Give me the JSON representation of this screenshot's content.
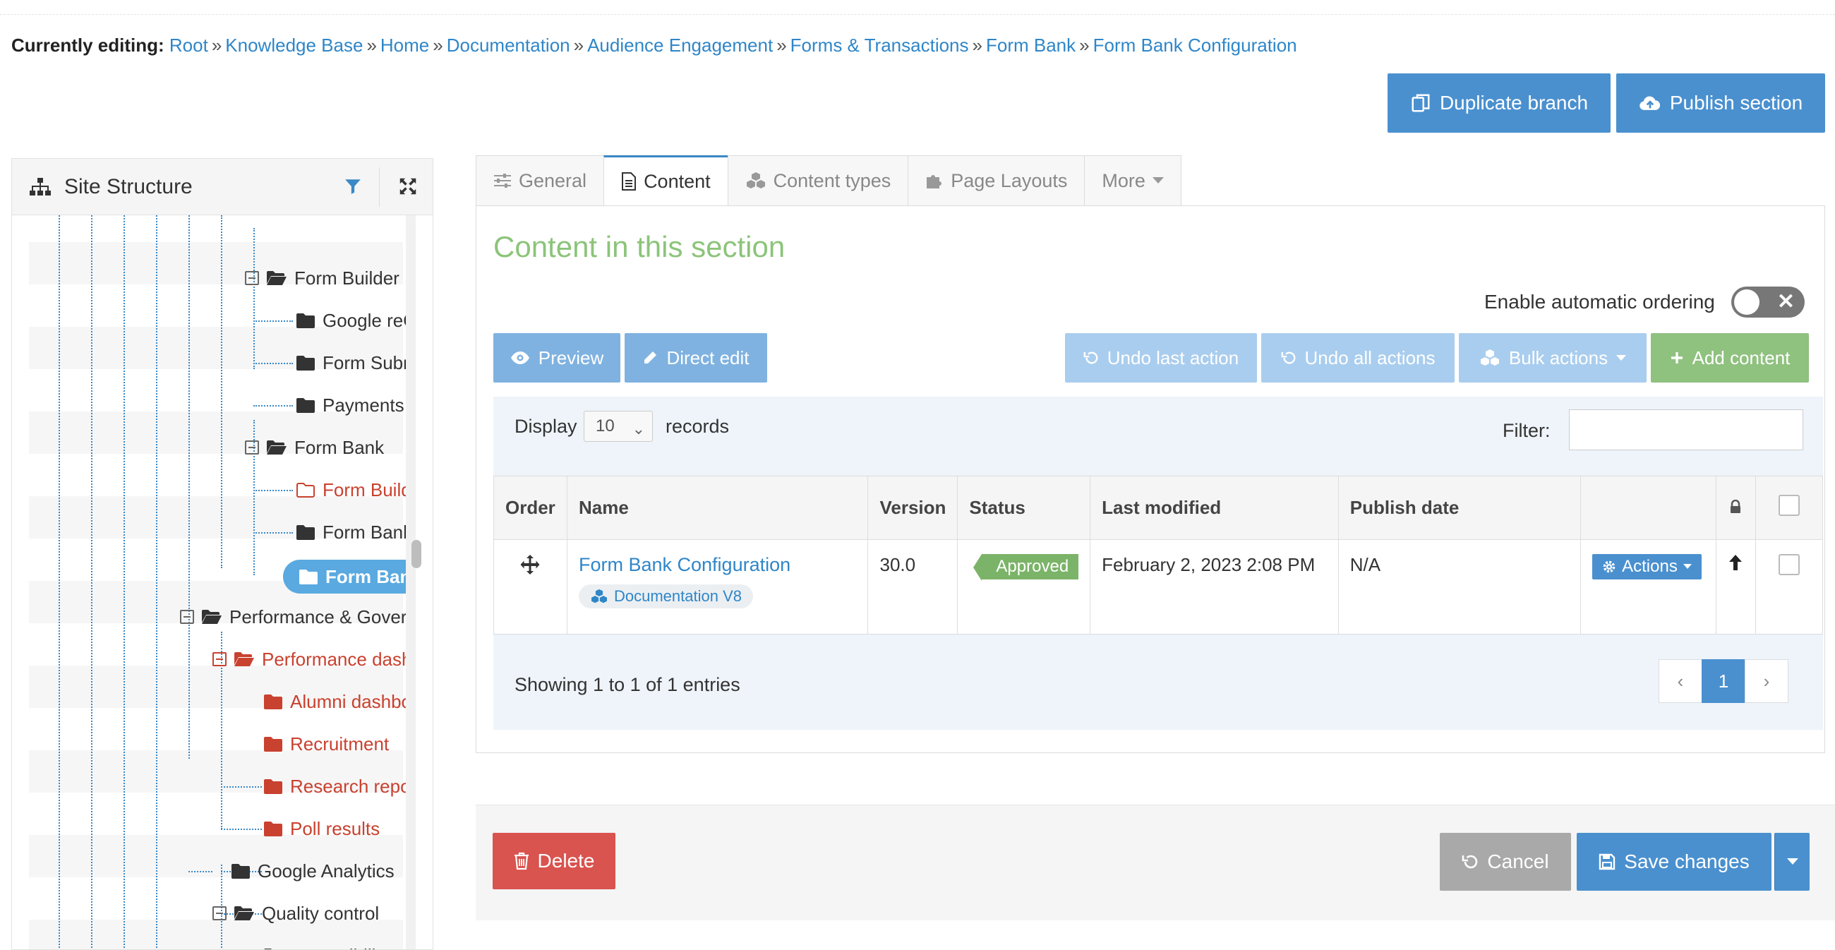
{
  "breadcrumb": {
    "label": "Currently editing:",
    "items": [
      "Root",
      "Knowledge Base",
      "Home",
      "Documentation",
      "Audience Engagement",
      "Forms & Transactions",
      "Form Bank",
      "Form Bank Configuration"
    ],
    "separator": "»"
  },
  "top_actions": {
    "duplicate": "Duplicate branch",
    "publish": "Publish section"
  },
  "sidebar": {
    "title": "Site Structure",
    "icons": [
      "sitemap-icon",
      "filter-icon",
      "expand-icon"
    ],
    "tree": [
      {
        "label": "Form Builder",
        "type": "folder-open",
        "state": "expanded",
        "color": "normal"
      },
      {
        "label": "Google reCAPTCHA",
        "type": "folder",
        "color": "normal"
      },
      {
        "label": "Form Submissions",
        "type": "folder",
        "color": "normal"
      },
      {
        "label": "Payments",
        "type": "folder",
        "color": "normal"
      },
      {
        "label": "Form Bank",
        "type": "folder-open",
        "state": "expanded",
        "color": "normal"
      },
      {
        "label": "Form Builder",
        "type": "folder-outline",
        "color": "red"
      },
      {
        "label": "Form Bank",
        "type": "folder",
        "color": "normal"
      },
      {
        "label": "Form Bank Configuration",
        "type": "folder",
        "color": "active"
      },
      {
        "label": "Performance & Governance",
        "type": "folder-open",
        "state": "expanded",
        "color": "normal"
      },
      {
        "label": "Performance dashboards",
        "type": "folder-open",
        "state": "expanded",
        "color": "red"
      },
      {
        "label": "Alumni dashboard",
        "type": "folder",
        "color": "red"
      },
      {
        "label": "Recruitment",
        "type": "folder",
        "color": "red"
      },
      {
        "label": "Research reports",
        "type": "folder",
        "color": "red"
      },
      {
        "label": "Poll results",
        "type": "folder",
        "color": "red"
      },
      {
        "label": "Google Analytics",
        "type": "folder",
        "color": "normal"
      },
      {
        "label": "Quality control",
        "type": "folder-open",
        "state": "expanded",
        "color": "normal"
      },
      {
        "label": "Accessibility",
        "type": "folder",
        "color": "normal"
      }
    ]
  },
  "tabs": [
    {
      "label": "General",
      "icon": "sliders-icon",
      "active": false
    },
    {
      "label": "Content",
      "icon": "document-icon",
      "active": true
    },
    {
      "label": "Content types",
      "icon": "cubes-icon",
      "active": false
    },
    {
      "label": "Page Layouts",
      "icon": "puzzle-icon",
      "active": false
    },
    {
      "label": "More",
      "icon": "caret-down-icon",
      "active": false
    }
  ],
  "content": {
    "title": "Content in this section",
    "auto_ordering_label": "Enable automatic ordering",
    "auto_ordering_on": false,
    "buttons": {
      "preview": "Preview",
      "direct_edit": "Direct edit",
      "undo_last": "Undo last action",
      "undo_all": "Undo all actions",
      "bulk": "Bulk actions",
      "add": "Add content"
    },
    "display_label": "Display",
    "display_value": "10",
    "records_label": "records",
    "filter_label": "Filter:",
    "filter_value": "",
    "columns": [
      "Order",
      "Name",
      "Version",
      "Status",
      "Last modified",
      "Publish date",
      "",
      "",
      ""
    ],
    "rows": [
      {
        "name": "Form Bank Configuration",
        "tag": "Documentation V8",
        "version": "30.0",
        "status": "Approved",
        "last_modified": "February 2, 2023 2:08 PM",
        "publish_date": "N/A",
        "actions": "Actions"
      }
    ],
    "showing": "Showing 1 to 1 of 1 entries",
    "pager": {
      "prev": "‹",
      "current": "1",
      "next": "›"
    }
  },
  "footer": {
    "delete": "Delete",
    "cancel": "Cancel",
    "save": "Save changes"
  },
  "colors": {
    "primary": "#4a90cf",
    "link": "#2f86c8",
    "success": "#8fc17f",
    "danger": "#d9534f",
    "tree_red": "#c9412f"
  }
}
